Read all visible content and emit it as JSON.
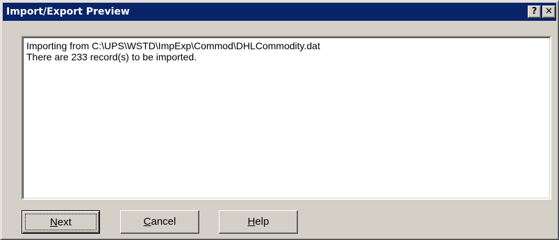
{
  "window": {
    "title": "Import/Export Preview",
    "help_button": "?",
    "close_button": "✕"
  },
  "log": {
    "lines": [
      "Importing from C:\\UPS\\WSTD\\ImpExp\\Commod\\DHLCommodity.dat",
      "There are 233 record(s) to be imported."
    ]
  },
  "buttons": {
    "next": {
      "accel": "N",
      "rest": "ext"
    },
    "cancel": {
      "accel": "C",
      "rest": "ancel"
    },
    "help": {
      "accel": "H",
      "rest": "elp"
    }
  },
  "colors": {
    "titlebar": "#0a246a",
    "face": "#d4d0c8"
  }
}
